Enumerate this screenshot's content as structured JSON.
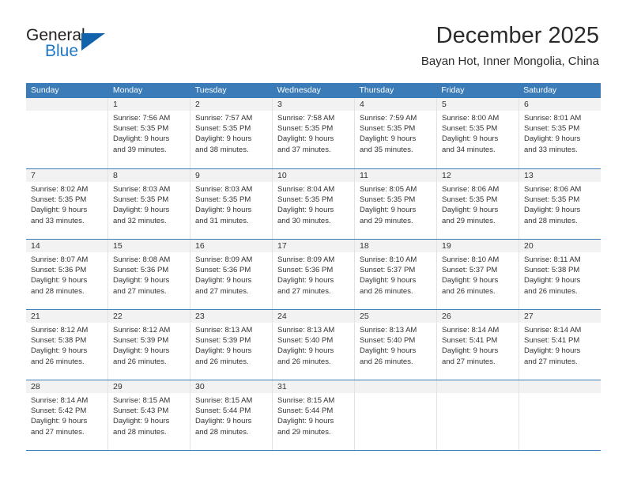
{
  "logo": {
    "primary_text": "General",
    "secondary_text": "Blue",
    "accent_color": "#1263ac",
    "secondary_color": "#2079c7"
  },
  "header": {
    "title": "December 2025",
    "subtitle": "Bayan Hot, Inner Mongolia, China"
  },
  "calendar": {
    "header_color": "#3b7cb8",
    "weekday_headers": [
      "Sunday",
      "Monday",
      "Tuesday",
      "Wednesday",
      "Thursday",
      "Friday",
      "Saturday"
    ],
    "weeks": [
      [
        {
          "day": "",
          "sunrise": "",
          "sunset": "",
          "daylight_line1": "",
          "daylight_line2": "",
          "empty": true
        },
        {
          "day": "1",
          "sunrise": "Sunrise: 7:56 AM",
          "sunset": "Sunset: 5:35 PM",
          "daylight_line1": "Daylight: 9 hours",
          "daylight_line2": "and 39 minutes.",
          "empty": false
        },
        {
          "day": "2",
          "sunrise": "Sunrise: 7:57 AM",
          "sunset": "Sunset: 5:35 PM",
          "daylight_line1": "Daylight: 9 hours",
          "daylight_line2": "and 38 minutes.",
          "empty": false
        },
        {
          "day": "3",
          "sunrise": "Sunrise: 7:58 AM",
          "sunset": "Sunset: 5:35 PM",
          "daylight_line1": "Daylight: 9 hours",
          "daylight_line2": "and 37 minutes.",
          "empty": false
        },
        {
          "day": "4",
          "sunrise": "Sunrise: 7:59 AM",
          "sunset": "Sunset: 5:35 PM",
          "daylight_line1": "Daylight: 9 hours",
          "daylight_line2": "and 35 minutes.",
          "empty": false
        },
        {
          "day": "5",
          "sunrise": "Sunrise: 8:00 AM",
          "sunset": "Sunset: 5:35 PM",
          "daylight_line1": "Daylight: 9 hours",
          "daylight_line2": "and 34 minutes.",
          "empty": false
        },
        {
          "day": "6",
          "sunrise": "Sunrise: 8:01 AM",
          "sunset": "Sunset: 5:35 PM",
          "daylight_line1": "Daylight: 9 hours",
          "daylight_line2": "and 33 minutes.",
          "empty": false
        }
      ],
      [
        {
          "day": "7",
          "sunrise": "Sunrise: 8:02 AM",
          "sunset": "Sunset: 5:35 PM",
          "daylight_line1": "Daylight: 9 hours",
          "daylight_line2": "and 33 minutes.",
          "empty": false
        },
        {
          "day": "8",
          "sunrise": "Sunrise: 8:03 AM",
          "sunset": "Sunset: 5:35 PM",
          "daylight_line1": "Daylight: 9 hours",
          "daylight_line2": "and 32 minutes.",
          "empty": false
        },
        {
          "day": "9",
          "sunrise": "Sunrise: 8:03 AM",
          "sunset": "Sunset: 5:35 PM",
          "daylight_line1": "Daylight: 9 hours",
          "daylight_line2": "and 31 minutes.",
          "empty": false
        },
        {
          "day": "10",
          "sunrise": "Sunrise: 8:04 AM",
          "sunset": "Sunset: 5:35 PM",
          "daylight_line1": "Daylight: 9 hours",
          "daylight_line2": "and 30 minutes.",
          "empty": false
        },
        {
          "day": "11",
          "sunrise": "Sunrise: 8:05 AM",
          "sunset": "Sunset: 5:35 PM",
          "daylight_line1": "Daylight: 9 hours",
          "daylight_line2": "and 29 minutes.",
          "empty": false
        },
        {
          "day": "12",
          "sunrise": "Sunrise: 8:06 AM",
          "sunset": "Sunset: 5:35 PM",
          "daylight_line1": "Daylight: 9 hours",
          "daylight_line2": "and 29 minutes.",
          "empty": false
        },
        {
          "day": "13",
          "sunrise": "Sunrise: 8:06 AM",
          "sunset": "Sunset: 5:35 PM",
          "daylight_line1": "Daylight: 9 hours",
          "daylight_line2": "and 28 minutes.",
          "empty": false
        }
      ],
      [
        {
          "day": "14",
          "sunrise": "Sunrise: 8:07 AM",
          "sunset": "Sunset: 5:36 PM",
          "daylight_line1": "Daylight: 9 hours",
          "daylight_line2": "and 28 minutes.",
          "empty": false
        },
        {
          "day": "15",
          "sunrise": "Sunrise: 8:08 AM",
          "sunset": "Sunset: 5:36 PM",
          "daylight_line1": "Daylight: 9 hours",
          "daylight_line2": "and 27 minutes.",
          "empty": false
        },
        {
          "day": "16",
          "sunrise": "Sunrise: 8:09 AM",
          "sunset": "Sunset: 5:36 PM",
          "daylight_line1": "Daylight: 9 hours",
          "daylight_line2": "and 27 minutes.",
          "empty": false
        },
        {
          "day": "17",
          "sunrise": "Sunrise: 8:09 AM",
          "sunset": "Sunset: 5:36 PM",
          "daylight_line1": "Daylight: 9 hours",
          "daylight_line2": "and 27 minutes.",
          "empty": false
        },
        {
          "day": "18",
          "sunrise": "Sunrise: 8:10 AM",
          "sunset": "Sunset: 5:37 PM",
          "daylight_line1": "Daylight: 9 hours",
          "daylight_line2": "and 26 minutes.",
          "empty": false
        },
        {
          "day": "19",
          "sunrise": "Sunrise: 8:10 AM",
          "sunset": "Sunset: 5:37 PM",
          "daylight_line1": "Daylight: 9 hours",
          "daylight_line2": "and 26 minutes.",
          "empty": false
        },
        {
          "day": "20",
          "sunrise": "Sunrise: 8:11 AM",
          "sunset": "Sunset: 5:38 PM",
          "daylight_line1": "Daylight: 9 hours",
          "daylight_line2": "and 26 minutes.",
          "empty": false
        }
      ],
      [
        {
          "day": "21",
          "sunrise": "Sunrise: 8:12 AM",
          "sunset": "Sunset: 5:38 PM",
          "daylight_line1": "Daylight: 9 hours",
          "daylight_line2": "and 26 minutes.",
          "empty": false
        },
        {
          "day": "22",
          "sunrise": "Sunrise: 8:12 AM",
          "sunset": "Sunset: 5:39 PM",
          "daylight_line1": "Daylight: 9 hours",
          "daylight_line2": "and 26 minutes.",
          "empty": false
        },
        {
          "day": "23",
          "sunrise": "Sunrise: 8:13 AM",
          "sunset": "Sunset: 5:39 PM",
          "daylight_line1": "Daylight: 9 hours",
          "daylight_line2": "and 26 minutes.",
          "empty": false
        },
        {
          "day": "24",
          "sunrise": "Sunrise: 8:13 AM",
          "sunset": "Sunset: 5:40 PM",
          "daylight_line1": "Daylight: 9 hours",
          "daylight_line2": "and 26 minutes.",
          "empty": false
        },
        {
          "day": "25",
          "sunrise": "Sunrise: 8:13 AM",
          "sunset": "Sunset: 5:40 PM",
          "daylight_line1": "Daylight: 9 hours",
          "daylight_line2": "and 26 minutes.",
          "empty": false
        },
        {
          "day": "26",
          "sunrise": "Sunrise: 8:14 AM",
          "sunset": "Sunset: 5:41 PM",
          "daylight_line1": "Daylight: 9 hours",
          "daylight_line2": "and 27 minutes.",
          "empty": false
        },
        {
          "day": "27",
          "sunrise": "Sunrise: 8:14 AM",
          "sunset": "Sunset: 5:41 PM",
          "daylight_line1": "Daylight: 9 hours",
          "daylight_line2": "and 27 minutes.",
          "empty": false
        }
      ],
      [
        {
          "day": "28",
          "sunrise": "Sunrise: 8:14 AM",
          "sunset": "Sunset: 5:42 PM",
          "daylight_line1": "Daylight: 9 hours",
          "daylight_line2": "and 27 minutes.",
          "empty": false
        },
        {
          "day": "29",
          "sunrise": "Sunrise: 8:15 AM",
          "sunset": "Sunset: 5:43 PM",
          "daylight_line1": "Daylight: 9 hours",
          "daylight_line2": "and 28 minutes.",
          "empty": false
        },
        {
          "day": "30",
          "sunrise": "Sunrise: 8:15 AM",
          "sunset": "Sunset: 5:44 PM",
          "daylight_line1": "Daylight: 9 hours",
          "daylight_line2": "and 28 minutes.",
          "empty": false
        },
        {
          "day": "31",
          "sunrise": "Sunrise: 8:15 AM",
          "sunset": "Sunset: 5:44 PM",
          "daylight_line1": "Daylight: 9 hours",
          "daylight_line2": "and 29 minutes.",
          "empty": false
        },
        {
          "day": "",
          "sunrise": "",
          "sunset": "",
          "daylight_line1": "",
          "daylight_line2": "",
          "empty": true
        },
        {
          "day": "",
          "sunrise": "",
          "sunset": "",
          "daylight_line1": "",
          "daylight_line2": "",
          "empty": true
        },
        {
          "day": "",
          "sunrise": "",
          "sunset": "",
          "daylight_line1": "",
          "daylight_line2": "",
          "empty": true
        }
      ]
    ]
  }
}
